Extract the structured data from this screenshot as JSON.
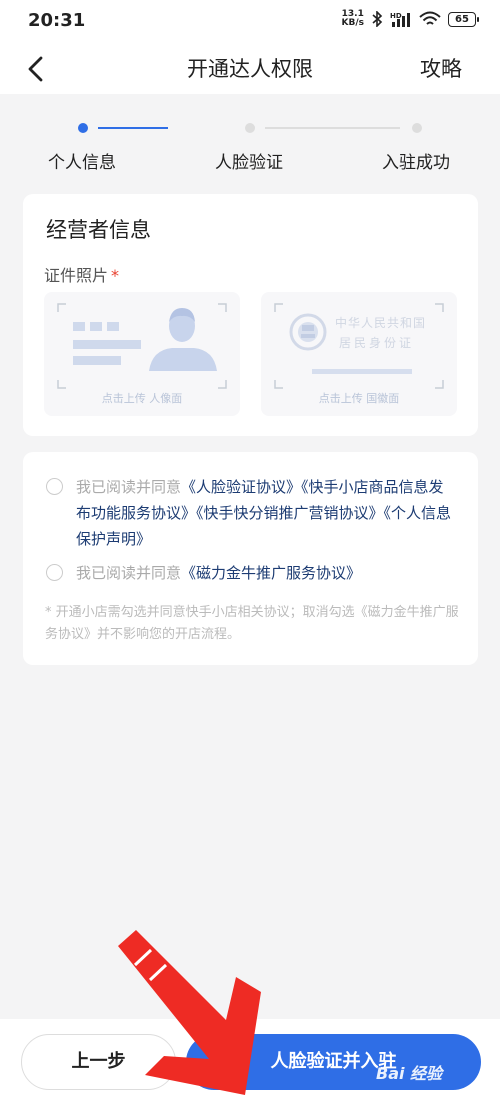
{
  "status": {
    "time": "20:31",
    "speed_value": "13.1",
    "speed_unit": "KB/s",
    "battery": "65"
  },
  "nav": {
    "title": "开通达人权限",
    "guide": "攻略"
  },
  "steps": [
    "个人信息",
    "人脸验证",
    "入驻成功"
  ],
  "operator": {
    "title": "经营者信息",
    "photo_label": "证件照片",
    "required_mark": "*",
    "portrait_caption": "点击上传 人像面",
    "emblem_caption": "点击上传 国徽面",
    "card_line1": "中华人民共和国",
    "card_line2": "居民身份证"
  },
  "agreements": {
    "row1_prefix": "我已阅读并同意",
    "row1_links": "《人脸验证协议》《快手小店商品信息发布功能服务协议》《快手快分销推广营销协议》《个人信息保护声明》",
    "row2_prefix": "我已阅读并同意",
    "row2_links": "《磁力金牛推广服务协议》",
    "note": "* 开通小店需勾选并同意快手小店相关协议；取消勾选《磁力金牛推广服务协议》并不影响您的开店流程。"
  },
  "buttons": {
    "prev": "上一步",
    "next": "人脸验证并入驻"
  },
  "watermark": "Bai 经验",
  "colors": {
    "accent": "#2f6ee6",
    "arrow": "#ee2b24",
    "link": "#1d3c73"
  }
}
